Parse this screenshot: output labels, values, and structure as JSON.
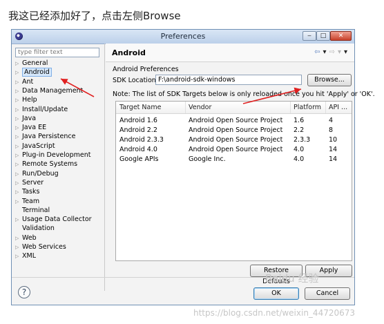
{
  "caption": "我这已经添加好了，点击左侧Browse",
  "window": {
    "title": "Preferences",
    "min": "‒",
    "max": "□",
    "close": "✕"
  },
  "filter": {
    "placeholder": "type filter text"
  },
  "tree": [
    {
      "label": "General",
      "arrow": true
    },
    {
      "label": "Android",
      "arrow": true,
      "selected": true
    },
    {
      "label": "Ant",
      "arrow": true
    },
    {
      "label": "Data Management",
      "arrow": true
    },
    {
      "label": "Help",
      "arrow": true
    },
    {
      "label": "Install/Update",
      "arrow": true
    },
    {
      "label": "Java",
      "arrow": true
    },
    {
      "label": "Java EE",
      "arrow": true
    },
    {
      "label": "Java Persistence",
      "arrow": true
    },
    {
      "label": "JavaScript",
      "arrow": true
    },
    {
      "label": "Plug-in Development",
      "arrow": true
    },
    {
      "label": "Remote Systems",
      "arrow": true
    },
    {
      "label": "Run/Debug",
      "arrow": true
    },
    {
      "label": "Server",
      "arrow": true
    },
    {
      "label": "Tasks",
      "arrow": true
    },
    {
      "label": "Team",
      "arrow": true
    },
    {
      "label": "Terminal",
      "arrow": false
    },
    {
      "label": "Usage Data Collector",
      "arrow": true
    },
    {
      "label": "Validation",
      "arrow": false
    },
    {
      "label": "Web",
      "arrow": true
    },
    {
      "label": "Web Services",
      "arrow": true
    },
    {
      "label": "XML",
      "arrow": true
    }
  ],
  "page": {
    "title": "Android",
    "section": "Android Preferences",
    "sdk_label": "SDK Location:",
    "sdk_value": "F:\\android-sdk-windows",
    "browse": "Browse...",
    "note": "Note: The list of SDK Targets below is only reloaded once you hit 'Apply' or 'OK'."
  },
  "table": {
    "headers": [
      "Target Name",
      "Vendor",
      "Platform",
      "API ..."
    ],
    "rows": [
      [
        "Android 1.6",
        "Android Open Source Project",
        "1.6",
        "4"
      ],
      [
        "Android 2.2",
        "Android Open Source Project",
        "2.2",
        "8"
      ],
      [
        "Android 2.3.3",
        "Android Open Source Project",
        "2.3.3",
        "10"
      ],
      [
        "Android 4.0",
        "Android Open Source Project",
        "4.0",
        "14"
      ],
      [
        "Google APIs",
        "Google Inc.",
        "4.0",
        "14"
      ]
    ]
  },
  "buttons": {
    "restore": "Restore Defaults",
    "apply": "Apply",
    "ok": "OK",
    "cancel": "Cancel",
    "help": "?"
  },
  "colors": {
    "annotation_arrow": "#e02020",
    "selection": "#d6e8fb",
    "titlebar": "#c9daf0"
  },
  "watermark": "https://blog.csdn.net/weixin_44720673"
}
